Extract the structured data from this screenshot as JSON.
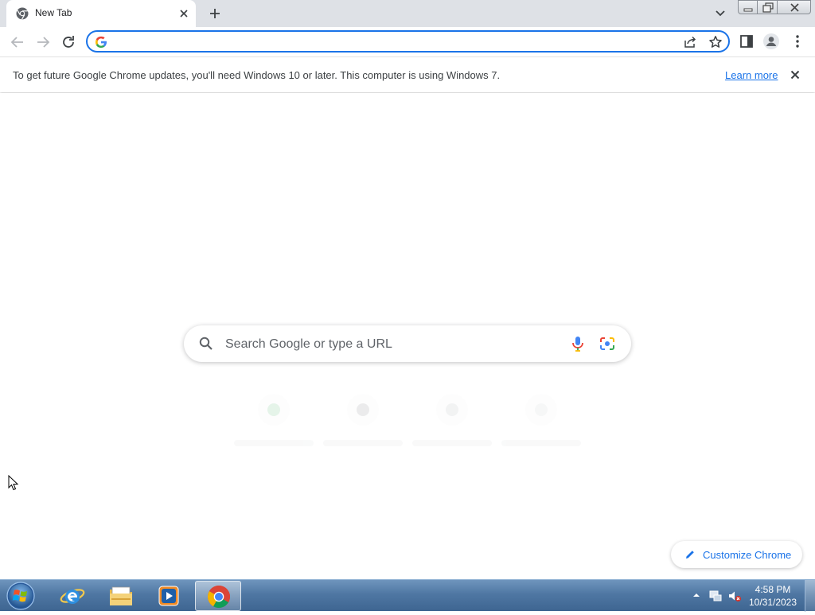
{
  "tab": {
    "title": "New Tab",
    "favicon": "chrome-icon",
    "close_icon": "close-icon"
  },
  "new_tab_icon": "plus-icon",
  "tab_search_icon": "chevron-down-icon",
  "window_controls": [
    "minimize-icon",
    "maximize-icon",
    "close-icon"
  ],
  "toolbar": {
    "back_icon": "arrow-left-icon",
    "forward_icon": "arrow-right-icon",
    "reload_icon": "reload-icon",
    "omnibox": {
      "value": "",
      "icon": "google-g-icon"
    },
    "share_icon": "share-icon",
    "bookmark_icon": "star-icon",
    "side_panel_icon": "side-panel-icon",
    "profile_icon": "profile-icon",
    "menu_icon": "kebab-menu-icon"
  },
  "infobar": {
    "message": "To get future Google Chrome updates, you'll need Windows 10 or later. This computer is using Windows 7.",
    "link": "Learn more"
  },
  "ntp": {
    "search_placeholder": "Search Google or type a URL",
    "customize_label": "Customize Chrome"
  },
  "taskbar": {
    "apps": [
      "windows-start-icon",
      "internet-explorer-icon",
      "file-explorer-icon",
      "media-player-icon",
      "chrome-icon"
    ],
    "clock_time": "4:58 PM",
    "clock_date": "10/31/2023"
  },
  "colors": {
    "accent": "#1a73e8",
    "tabstrip": "#dee1e6",
    "taskbar": "#4f77a3"
  }
}
